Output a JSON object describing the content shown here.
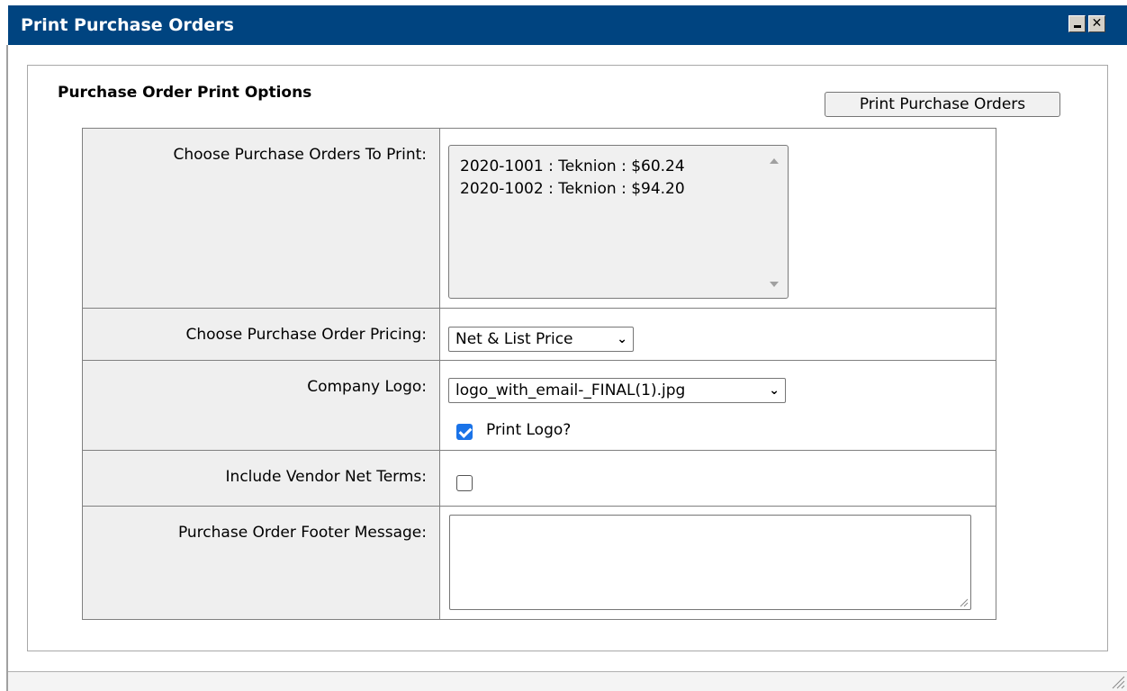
{
  "window": {
    "title": "Print Purchase Orders",
    "minimize_icon": "minimize-icon",
    "close_icon": "close-icon"
  },
  "section": {
    "title": "Purchase Order Print Options",
    "print_button_label": "Print Purchase Orders"
  },
  "options": {
    "purchase_orders": {
      "label": "Choose Purchase Orders To Print:",
      "items": [
        "2020-1001 : Teknion : $60.24",
        "2020-1002 : Teknion : $94.20"
      ]
    },
    "pricing": {
      "label": "Choose Purchase Order Pricing:",
      "selected": "Net & List Price"
    },
    "logo": {
      "label": "Company Logo:",
      "selected": "logo_with_email-_FINAL(1).jpg",
      "print_logo_label": "Print Logo?",
      "print_logo_checked": true
    },
    "vendor_terms": {
      "label": "Include Vendor Net Terms:",
      "checked": false
    },
    "footer": {
      "label": "Purchase Order Footer Message:",
      "value": ""
    }
  },
  "colors": {
    "titlebar": "#004480",
    "label_bg": "#efefef",
    "checkbox_on": "#1a73e8"
  }
}
